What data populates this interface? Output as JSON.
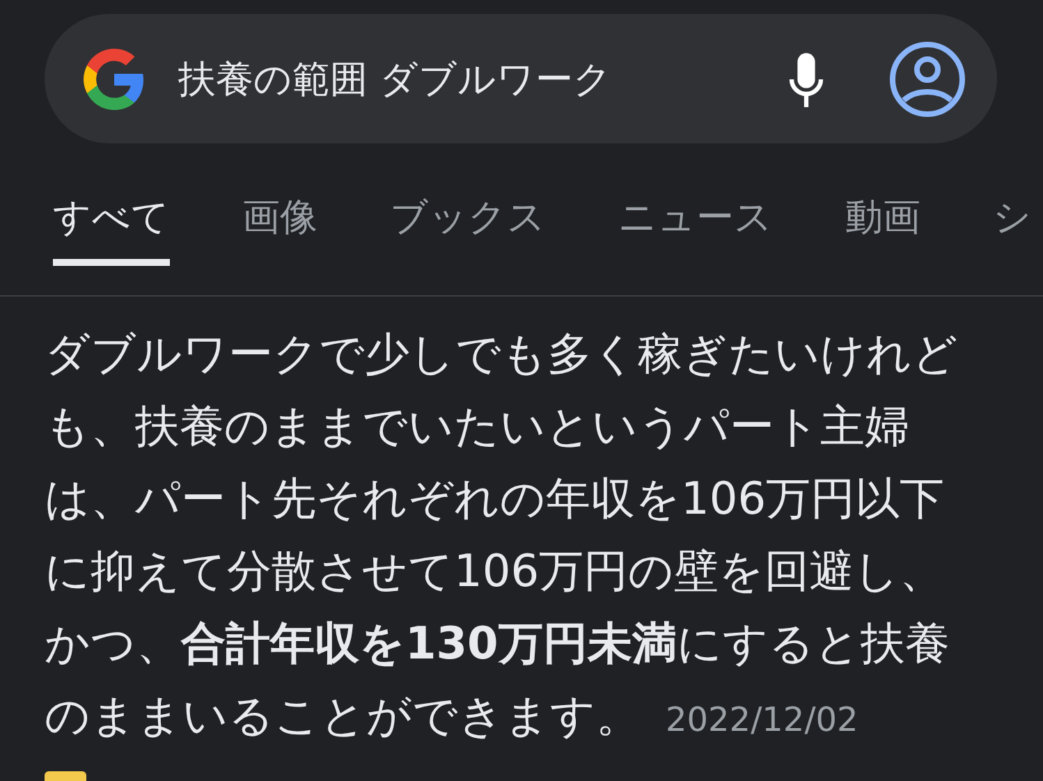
{
  "search": {
    "value": "扶養の範囲 ダブルワーク"
  },
  "tabs": [
    {
      "label": "すべて",
      "selected": true
    },
    {
      "label": "画像",
      "selected": false
    },
    {
      "label": "ブックス",
      "selected": false
    },
    {
      "label": "ニュース",
      "selected": false
    },
    {
      "label": "動画",
      "selected": false
    },
    {
      "label": "シ",
      "selected": false
    }
  ],
  "snippet": {
    "lines": [
      "ダブルワークで少しでも多く稼ぎたいけれど",
      "も、扶養のままでいたいというパート主婦",
      "は、パート先それぞれの年収を106万円以下",
      "に抑えて分散させて106万円の壁を回避し、",
      "かつ、**合計年収を130万円未満**にすると扶養",
      "のままいることができます。"
    ],
    "date": "2022/12/02"
  }
}
